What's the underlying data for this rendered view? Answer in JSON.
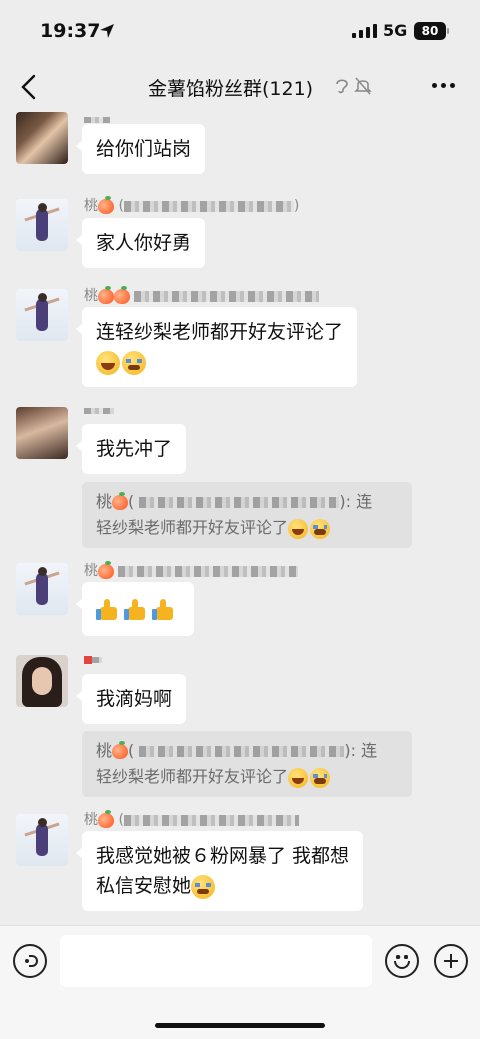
{
  "status_bar": {
    "time": "19:37",
    "network": "5G",
    "battery": "80"
  },
  "nav": {
    "title": "金薯馅粉丝群(121)"
  },
  "messages": [
    {
      "text": "给你们站岗"
    },
    {
      "sender_prefix": "桃",
      "sender_suffix": "(",
      "sender_end": ")",
      "text": "家人你好勇"
    },
    {
      "sender_prefix": "桃",
      "text": "连轻纱梨老师都开好友评论了"
    },
    {
      "text": "我先冲了",
      "quote_prefix": "桃",
      "quote_sep": "):",
      "quote_text1": "连",
      "quote_text2": "轻纱梨老师都开好友评论了"
    },
    {
      "sender_prefix": "桃"
    },
    {
      "text": "我滴妈啊",
      "quote_prefix": "桃",
      "quote_sep": "):",
      "quote_text1": "连",
      "quote_text2": "轻纱梨老师都开好友评论了"
    },
    {
      "sender_prefix": "桃",
      "sender_suffix": "(",
      "text1": "我感觉她被６粉网暴了 我都想",
      "text2": "私信安慰她"
    }
  ],
  "input": {
    "placeholder": ""
  },
  "icons": [
    "location-arrow-icon",
    "ear-icon",
    "mute-bell-icon",
    "more-icon",
    "voice-icon",
    "emoji-icon",
    "plus-icon"
  ]
}
